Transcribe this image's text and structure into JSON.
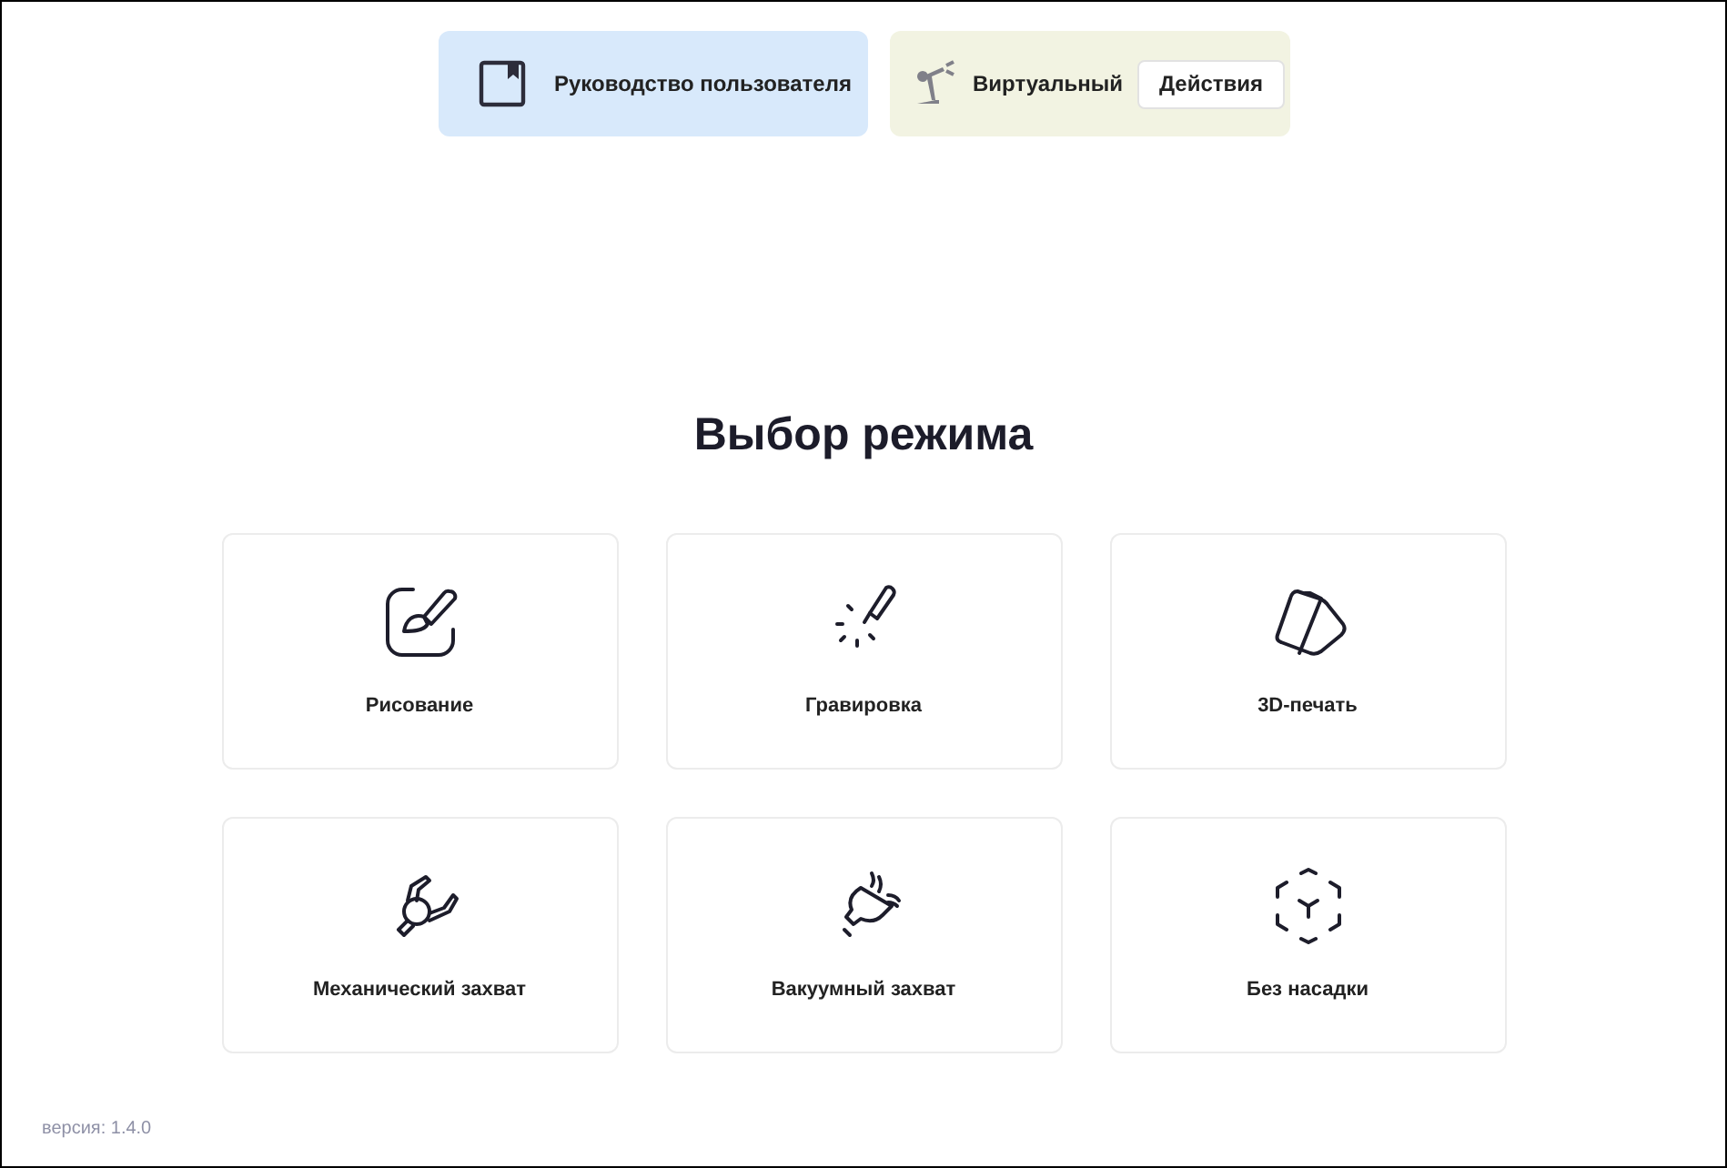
{
  "header": {
    "manual": {
      "label": "Руководство пользователя"
    },
    "robot": {
      "label": "Виртуальный",
      "action": "Действия"
    }
  },
  "title": "Выбор режима",
  "modes": [
    {
      "kind": "drawing",
      "label": "Рисование"
    },
    {
      "kind": "engraving",
      "label": "Гравировка"
    },
    {
      "kind": "printing",
      "label": "3D-печать"
    },
    {
      "kind": "gripper",
      "label": "Механический захват"
    },
    {
      "kind": "vacuum",
      "label": "Вакуумный захват"
    },
    {
      "kind": "none",
      "label": "Без насадки"
    }
  ],
  "version": "версия: 1.4.0"
}
